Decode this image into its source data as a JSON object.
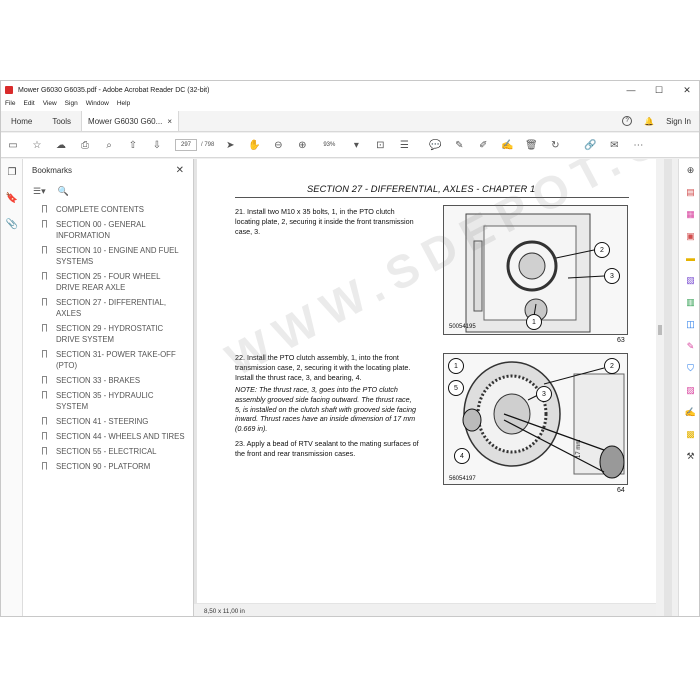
{
  "window": {
    "title": "Mower G6030 G6035.pdf - Adobe Acrobat Reader DC (32-bit)",
    "minimize": "—",
    "maximize": "☐",
    "close": "✕"
  },
  "menu": [
    "File",
    "Edit",
    "View",
    "Sign",
    "Window",
    "Help"
  ],
  "tabs": {
    "home": "Home",
    "tools": "Tools",
    "document": "Mower G6030 G60...",
    "doc_close": "×",
    "signin": "Sign In"
  },
  "toolbar": {
    "page_current": "297",
    "page_total": "/ 798",
    "zoom": "93%"
  },
  "bookmarks": {
    "title": "Bookmarks",
    "items": [
      "COMPLETE CONTENTS",
      "SECTION 00 - GENERAL INFORMATION",
      "SECTION 10 - ENGINE AND FUEL SYSTEMS",
      "SECTION 25 - FOUR WHEEL DRIVE REAR AXLE",
      "SECTION 27 - DIFFERENTIAL, AXLES",
      "SECTION 29 - HYDROSTATIC DRIVE SYSTEM",
      "SECTION 31- POWER TAKE-OFF (PTO)",
      "SECTION 33 - BRAKES",
      "SECTION 35 - HYDRAULIC SYSTEM",
      "SECTION 41 - STEERING",
      "SECTION 44 - WHEELS AND TIRES",
      "SECTION 55 - ELECTRICAL",
      "SECTION 90 - PLATFORM"
    ]
  },
  "page": {
    "section_header": "SECTION 27 - DIFFERENTIAL, AXLES - CHAPTER 1",
    "step21": "21. Install two M10 x 35 bolts, 1, in the PTO clutch locating plate, 2, securing it inside the front transmission case, 3.",
    "step22": "22. Install the PTO clutch assembly, 1, into the front transmission case, 2, securing it with the locating plate. Install the thrust race, 3, and bearing, 4.",
    "note": "NOTE: The thrust race, 3, goes into the PTO clutch assembly grooved side facing outward. The thrust race, 5, is installed on the clutch shaft with grooved side facing inward. Thrust races have an inside dimension of 17 mm (0.669 in).",
    "step23": "23. Apply a bead of RTV sealant to the mating surfaces of the front and rear transmission cases.",
    "fig1_code": "50054195",
    "fig1_num": "63",
    "fig2_code": "56054197",
    "fig2_num": "64",
    "fig2_dim": "17 mm",
    "callouts1": [
      "1",
      "2",
      "3"
    ],
    "callouts2": [
      "1",
      "2",
      "3",
      "4",
      "5"
    ],
    "watermark": "WWW.SDEPOT.COM"
  },
  "status": {
    "page_size": "8,50 x 11,00 in"
  }
}
